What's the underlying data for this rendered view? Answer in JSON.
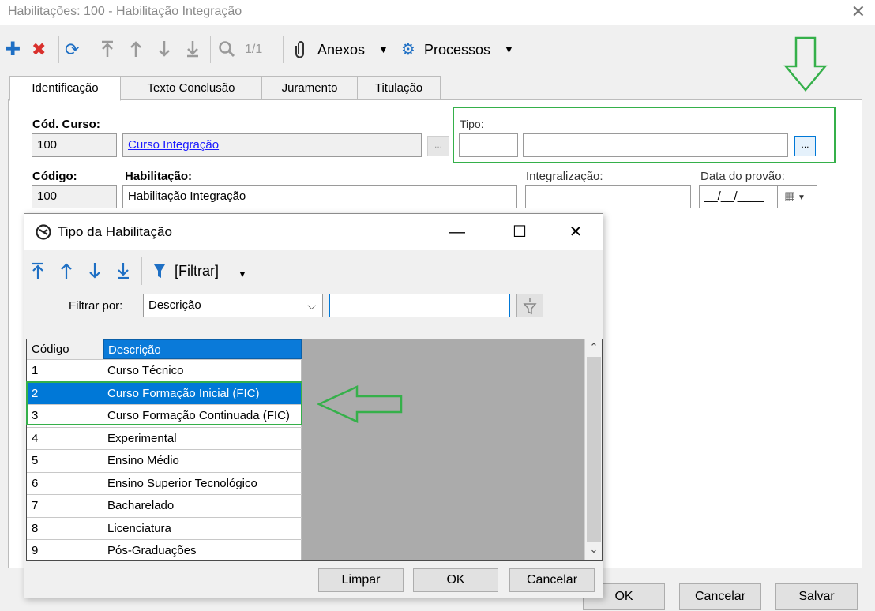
{
  "window": {
    "title": "Habilitações: 100 - Habilitação Integração",
    "close": "✕"
  },
  "toolbar": {
    "page_indicator": "1/1",
    "anexos_label": "Anexos",
    "processos_label": "Processos",
    "icons": [
      "add-icon",
      "delete-icon",
      "refresh-icon",
      "first-record-icon",
      "previous-record-icon",
      "next-record-icon",
      "last-record-icon",
      "search-icon",
      "paperclip-icon",
      "gear-icon"
    ]
  },
  "tabs": [
    {
      "label": "Identificação",
      "active": true
    },
    {
      "label": "Texto Conclusão",
      "active": false
    },
    {
      "label": "Juramento",
      "active": false
    },
    {
      "label": "Titulação",
      "active": false
    }
  ],
  "form": {
    "cod_curso_label": "Cód. Curso:",
    "cod_curso_value": "100",
    "curso_nome": "Curso Integração",
    "tipo_label": "Tipo:",
    "tipo_code": "",
    "tipo_desc": "",
    "codigo_label": "Código:",
    "codigo_value": "100",
    "habilitacao_label": "Habilitação:",
    "habilitacao_value": "Habilitação Integração",
    "integralizacao_label": "Integralização:",
    "integralizacao_value": "",
    "data_provao_label": "Data do provão:",
    "data_provao_value": "__/__/____",
    "lookup_button": "..."
  },
  "footer": {
    "ok": "OK",
    "cancelar": "Cancelar",
    "salvar": "Salvar"
  },
  "dialog": {
    "title": "Tipo da Habilitação",
    "filter_menu": "[Filtrar]",
    "filter_by_label": "Filtrar por:",
    "filter_field": "Descrição",
    "filter_value": "",
    "columns": [
      "Código",
      "Descrição"
    ],
    "rows": [
      {
        "codigo": "1",
        "descricao": "Curso Técnico",
        "selected": false
      },
      {
        "codigo": "2",
        "descricao": "Curso Formação Inicial (FIC)",
        "selected": true
      },
      {
        "codigo": "3",
        "descricao": "Curso Formação Continuada (FIC)",
        "selected": false
      },
      {
        "codigo": "4",
        "descricao": "Experimental",
        "selected": false
      },
      {
        "codigo": "5",
        "descricao": "Ensino Médio",
        "selected": false
      },
      {
        "codigo": "6",
        "descricao": "Ensino Superior Tecnológico",
        "selected": false
      },
      {
        "codigo": "7",
        "descricao": "Bacharelado",
        "selected": false
      },
      {
        "codigo": "8",
        "descricao": "Licenciatura",
        "selected": false
      },
      {
        "codigo": "9",
        "descricao": "Pós-Graduações",
        "selected": false
      }
    ],
    "buttons": {
      "limpar": "Limpar",
      "ok": "OK",
      "cancelar": "Cancelar"
    }
  },
  "colors": {
    "accent_blue": "#0078d7",
    "annotation_green": "#35b04a",
    "delete_red": "#d9302c"
  }
}
